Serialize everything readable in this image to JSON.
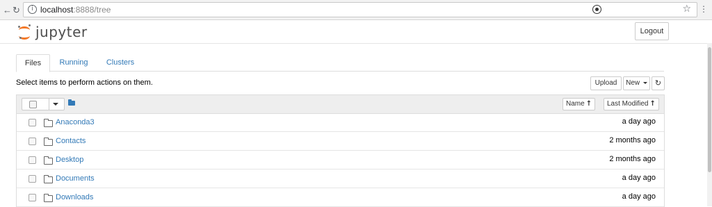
{
  "browser": {
    "host": "localhost",
    "path": ":8888/tree",
    "info_glyph": "i",
    "star_glyph": "☆",
    "menu_glyph": "⋮",
    "back_icon": "back-arrow-icon",
    "reload_icon": "reload-icon"
  },
  "header": {
    "logo_text": "jupyter",
    "logout_label": "Logout"
  },
  "tabs": [
    {
      "label": "Files",
      "active": true
    },
    {
      "label": "Running",
      "active": false
    },
    {
      "label": "Clusters",
      "active": false
    }
  ],
  "toolbar": {
    "instructions": "Select items to perform actions on them.",
    "upload_label": "Upload",
    "new_label": "New",
    "refresh_icon": "refresh-icon"
  },
  "list_header": {
    "name_label": "Name",
    "last_modified_label": "Last Modified",
    "sort_arrow": "↑"
  },
  "items": [
    {
      "name": "Anaconda3",
      "modified": "a day ago"
    },
    {
      "name": "Contacts",
      "modified": "2 months ago"
    },
    {
      "name": "Desktop",
      "modified": "2 months ago"
    },
    {
      "name": "Documents",
      "modified": "a day ago"
    },
    {
      "name": "Downloads",
      "modified": "a day ago"
    }
  ],
  "colors": {
    "link": "#337ab7",
    "logo_orange": "#f37726",
    "header_bg": "#eeeeee"
  }
}
